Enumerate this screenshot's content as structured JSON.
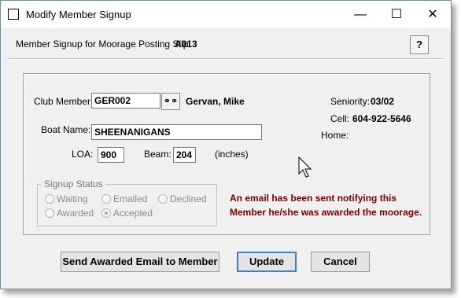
{
  "window": {
    "title": "Modify Member Signup"
  },
  "header": {
    "label": "Member Signup for Moorage Posting Slip:",
    "slip": "A013"
  },
  "member": {
    "club_member_label": "Club Member:",
    "club_member_value": "GER002",
    "name": "Gervan, Mike",
    "seniority_label": "Seniority:",
    "seniority_value": "03/02",
    "cell_label": "Cell:",
    "cell_value": "604-922-5646",
    "home_label": "Home:",
    "home_value": ""
  },
  "boat": {
    "name_label": "Boat Name:",
    "name_value": "SHEENANIGANS",
    "loa_label": "LOA:",
    "loa_value": "900",
    "beam_label": "Beam:",
    "beam_value": "204",
    "units": "(inches)"
  },
  "status": {
    "group_title": "Signup Status",
    "options": [
      {
        "label": "Waiting",
        "checked": false
      },
      {
        "label": "Emailed",
        "checked": false
      },
      {
        "label": "Declined",
        "checked": false
      },
      {
        "label": "Awarded",
        "checked": false
      },
      {
        "label": "Accepted",
        "checked": true
      }
    ]
  },
  "message": {
    "line1": "An email has been sent notifying this",
    "line2": "Member he/she was awarded the moorage."
  },
  "buttons": {
    "send_email": "Send Awarded Email to Member",
    "update": "Update",
    "cancel": "Cancel"
  },
  "icons": {
    "title": "window-icon",
    "help": "help-icon",
    "lookup": "binoculars-icon"
  },
  "colors": {
    "message": "#7a0000",
    "default_button_border": "#3c7fcf"
  }
}
